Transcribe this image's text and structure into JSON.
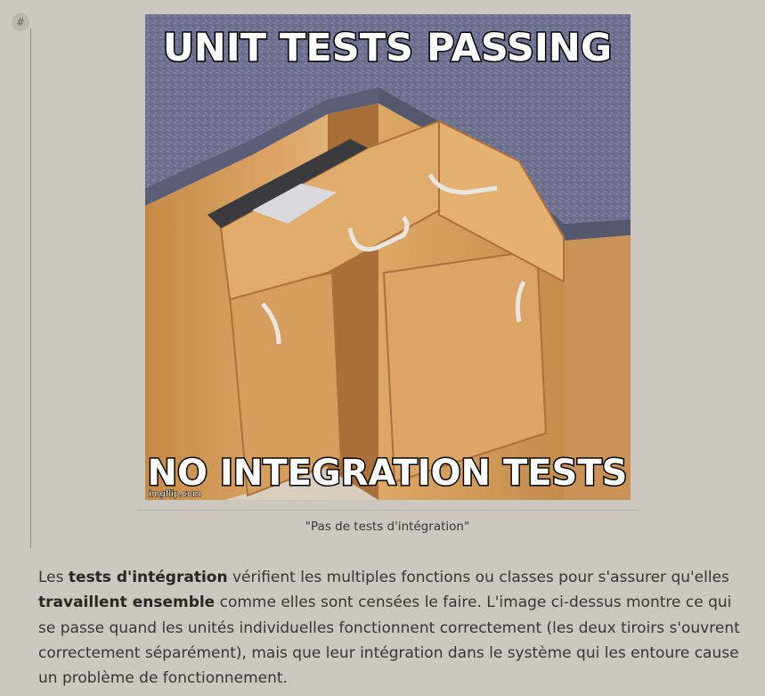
{
  "anchor": {
    "glyph": "#",
    "icon": "hash-icon"
  },
  "figure": {
    "meme_top_text": "UNIT TESTS PASSING",
    "meme_bottom_text": "NO INTEGRATION TESTS",
    "watermark": "imgflip.com",
    "caption": "\"Pas de tests d'intégration\""
  },
  "paragraph": {
    "t1": "Les ",
    "b1": "tests d'intégration",
    "t2": " vérifient les multiples fonctions ou classes pour s'assurer qu'elles ",
    "b2": "travaillent ensemble",
    "t3": " comme elles sont censées le faire. L'image ci-dessus montre ce qui se passe quand les unités individuelles fonctionnent correctement (les deux tiroirs s'ouvrent correctement séparément), mais que leur intégration dans le système qui les entoure cause un problème de fonctionnement."
  },
  "colors": {
    "background": "#ccc7bf",
    "text": "#3a352f",
    "countertop": "#6b6f8c",
    "wood": "#d9a463"
  }
}
